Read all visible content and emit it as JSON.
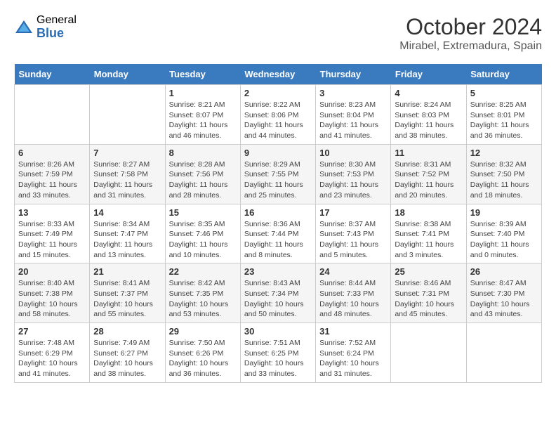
{
  "logo": {
    "general": "General",
    "blue": "Blue"
  },
  "title": "October 2024",
  "location": "Mirabel, Extremadura, Spain",
  "days_header": [
    "Sunday",
    "Monday",
    "Tuesday",
    "Wednesday",
    "Thursday",
    "Friday",
    "Saturday"
  ],
  "weeks": [
    [
      {
        "num": "",
        "sunrise": "",
        "sunset": "",
        "daylight": ""
      },
      {
        "num": "",
        "sunrise": "",
        "sunset": "",
        "daylight": ""
      },
      {
        "num": "1",
        "sunrise": "Sunrise: 8:21 AM",
        "sunset": "Sunset: 8:07 PM",
        "daylight": "Daylight: 11 hours and 46 minutes."
      },
      {
        "num": "2",
        "sunrise": "Sunrise: 8:22 AM",
        "sunset": "Sunset: 8:06 PM",
        "daylight": "Daylight: 11 hours and 44 minutes."
      },
      {
        "num": "3",
        "sunrise": "Sunrise: 8:23 AM",
        "sunset": "Sunset: 8:04 PM",
        "daylight": "Daylight: 11 hours and 41 minutes."
      },
      {
        "num": "4",
        "sunrise": "Sunrise: 8:24 AM",
        "sunset": "Sunset: 8:03 PM",
        "daylight": "Daylight: 11 hours and 38 minutes."
      },
      {
        "num": "5",
        "sunrise": "Sunrise: 8:25 AM",
        "sunset": "Sunset: 8:01 PM",
        "daylight": "Daylight: 11 hours and 36 minutes."
      }
    ],
    [
      {
        "num": "6",
        "sunrise": "Sunrise: 8:26 AM",
        "sunset": "Sunset: 7:59 PM",
        "daylight": "Daylight: 11 hours and 33 minutes."
      },
      {
        "num": "7",
        "sunrise": "Sunrise: 8:27 AM",
        "sunset": "Sunset: 7:58 PM",
        "daylight": "Daylight: 11 hours and 31 minutes."
      },
      {
        "num": "8",
        "sunrise": "Sunrise: 8:28 AM",
        "sunset": "Sunset: 7:56 PM",
        "daylight": "Daylight: 11 hours and 28 minutes."
      },
      {
        "num": "9",
        "sunrise": "Sunrise: 8:29 AM",
        "sunset": "Sunset: 7:55 PM",
        "daylight": "Daylight: 11 hours and 25 minutes."
      },
      {
        "num": "10",
        "sunrise": "Sunrise: 8:30 AM",
        "sunset": "Sunset: 7:53 PM",
        "daylight": "Daylight: 11 hours and 23 minutes."
      },
      {
        "num": "11",
        "sunrise": "Sunrise: 8:31 AM",
        "sunset": "Sunset: 7:52 PM",
        "daylight": "Daylight: 11 hours and 20 minutes."
      },
      {
        "num": "12",
        "sunrise": "Sunrise: 8:32 AM",
        "sunset": "Sunset: 7:50 PM",
        "daylight": "Daylight: 11 hours and 18 minutes."
      }
    ],
    [
      {
        "num": "13",
        "sunrise": "Sunrise: 8:33 AM",
        "sunset": "Sunset: 7:49 PM",
        "daylight": "Daylight: 11 hours and 15 minutes."
      },
      {
        "num": "14",
        "sunrise": "Sunrise: 8:34 AM",
        "sunset": "Sunset: 7:47 PM",
        "daylight": "Daylight: 11 hours and 13 minutes."
      },
      {
        "num": "15",
        "sunrise": "Sunrise: 8:35 AM",
        "sunset": "Sunset: 7:46 PM",
        "daylight": "Daylight: 11 hours and 10 minutes."
      },
      {
        "num": "16",
        "sunrise": "Sunrise: 8:36 AM",
        "sunset": "Sunset: 7:44 PM",
        "daylight": "Daylight: 11 hours and 8 minutes."
      },
      {
        "num": "17",
        "sunrise": "Sunrise: 8:37 AM",
        "sunset": "Sunset: 7:43 PM",
        "daylight": "Daylight: 11 hours and 5 minutes."
      },
      {
        "num": "18",
        "sunrise": "Sunrise: 8:38 AM",
        "sunset": "Sunset: 7:41 PM",
        "daylight": "Daylight: 11 hours and 3 minutes."
      },
      {
        "num": "19",
        "sunrise": "Sunrise: 8:39 AM",
        "sunset": "Sunset: 7:40 PM",
        "daylight": "Daylight: 11 hours and 0 minutes."
      }
    ],
    [
      {
        "num": "20",
        "sunrise": "Sunrise: 8:40 AM",
        "sunset": "Sunset: 7:38 PM",
        "daylight": "Daylight: 10 hours and 58 minutes."
      },
      {
        "num": "21",
        "sunrise": "Sunrise: 8:41 AM",
        "sunset": "Sunset: 7:37 PM",
        "daylight": "Daylight: 10 hours and 55 minutes."
      },
      {
        "num": "22",
        "sunrise": "Sunrise: 8:42 AM",
        "sunset": "Sunset: 7:35 PM",
        "daylight": "Daylight: 10 hours and 53 minutes."
      },
      {
        "num": "23",
        "sunrise": "Sunrise: 8:43 AM",
        "sunset": "Sunset: 7:34 PM",
        "daylight": "Daylight: 10 hours and 50 minutes."
      },
      {
        "num": "24",
        "sunrise": "Sunrise: 8:44 AM",
        "sunset": "Sunset: 7:33 PM",
        "daylight": "Daylight: 10 hours and 48 minutes."
      },
      {
        "num": "25",
        "sunrise": "Sunrise: 8:46 AM",
        "sunset": "Sunset: 7:31 PM",
        "daylight": "Daylight: 10 hours and 45 minutes."
      },
      {
        "num": "26",
        "sunrise": "Sunrise: 8:47 AM",
        "sunset": "Sunset: 7:30 PM",
        "daylight": "Daylight: 10 hours and 43 minutes."
      }
    ],
    [
      {
        "num": "27",
        "sunrise": "Sunrise: 7:48 AM",
        "sunset": "Sunset: 6:29 PM",
        "daylight": "Daylight: 10 hours and 41 minutes."
      },
      {
        "num": "28",
        "sunrise": "Sunrise: 7:49 AM",
        "sunset": "Sunset: 6:27 PM",
        "daylight": "Daylight: 10 hours and 38 minutes."
      },
      {
        "num": "29",
        "sunrise": "Sunrise: 7:50 AM",
        "sunset": "Sunset: 6:26 PM",
        "daylight": "Daylight: 10 hours and 36 minutes."
      },
      {
        "num": "30",
        "sunrise": "Sunrise: 7:51 AM",
        "sunset": "Sunset: 6:25 PM",
        "daylight": "Daylight: 10 hours and 33 minutes."
      },
      {
        "num": "31",
        "sunrise": "Sunrise: 7:52 AM",
        "sunset": "Sunset: 6:24 PM",
        "daylight": "Daylight: 10 hours and 31 minutes."
      },
      {
        "num": "",
        "sunrise": "",
        "sunset": "",
        "daylight": ""
      },
      {
        "num": "",
        "sunrise": "",
        "sunset": "",
        "daylight": ""
      }
    ]
  ]
}
